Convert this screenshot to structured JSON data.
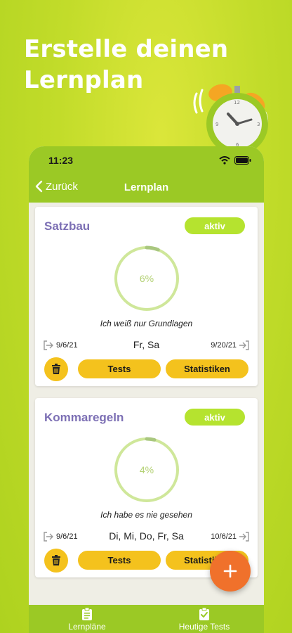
{
  "promo": {
    "line1": "Erstelle deinen",
    "line2": "Lernplan"
  },
  "status_bar": {
    "time": "11:23"
  },
  "nav": {
    "back_label": "Zurück",
    "title": "Lernplan"
  },
  "cards": [
    {
      "title": "Satzbau",
      "status": "aktiv",
      "progress_percent": 6,
      "progress_text": "6%",
      "level": "Ich weiß nur Grundlagen",
      "start_date": "9/6/21",
      "days": "Fr, Sa",
      "end_date": "9/20/21",
      "tests_label": "Tests",
      "stats_label": "Statistiken"
    },
    {
      "title": "Kommaregeln",
      "status": "aktiv",
      "progress_percent": 4,
      "progress_text": "4%",
      "level": "Ich habe es nie gesehen",
      "start_date": "9/6/21",
      "days": "Di, Mi, Do, Fr, Sa",
      "end_date": "10/6/21",
      "tests_label": "Tests",
      "stats_label": "Statistiken"
    }
  ],
  "tabs": [
    {
      "label": "Lernpläne",
      "icon": "clipboard-list-icon"
    },
    {
      "label": "Heutige Tests",
      "icon": "clipboard-check-icon"
    }
  ],
  "colors": {
    "background": "#c2dc2a",
    "header": "#9bc925",
    "card_title": "#7c6fb4",
    "badge": "#b5e32f",
    "button": "#f4c21d",
    "fab": "#f0712b",
    "ring_track": "#cfe79a",
    "ring_progress": "#a9c77f"
  }
}
